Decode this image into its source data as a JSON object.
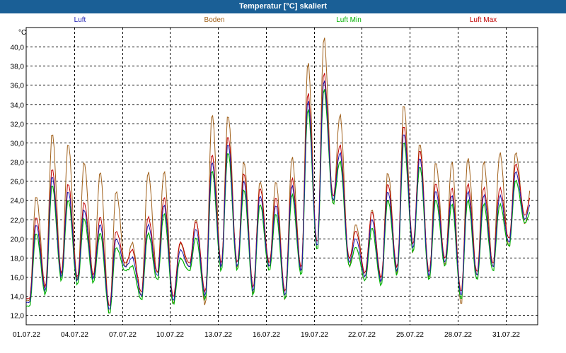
{
  "window": {
    "title": "Temperatur [°C] skaliert"
  },
  "chart_data": {
    "type": "line",
    "title": "Temperatur [°C] skaliert",
    "ylabel": "°C",
    "ylim": [
      11.0,
      42.0
    ],
    "yticks": [
      "12,0",
      "14,0",
      "16,0",
      "18,0",
      "20,0",
      "22,0",
      "24,0",
      "26,0",
      "28,0",
      "30,0",
      "32,0",
      "34,0",
      "36,0",
      "38,0",
      "40,0"
    ],
    "xticks": [
      "01.07.22",
      "04.07.22",
      "07.07.22",
      "10.07.22",
      "13.07.22",
      "16.07.22",
      "19.07.22",
      "22.07.22",
      "25.07.22",
      "28.07.22",
      "31.07.22"
    ],
    "xrange_days": [
      1.0,
      33.0
    ],
    "grid": true,
    "legend_position": "top",
    "series": [
      {
        "name": "Luft",
        "color": "#1a1ab0"
      },
      {
        "name": "Boden",
        "color": "#a0601a"
      },
      {
        "name": "Luft Min",
        "color": "#00b000"
      },
      {
        "name": "Luft Max",
        "color": "#c00000"
      }
    ],
    "daily": {
      "days": [
        1,
        2,
        3,
        4,
        5,
        6,
        7,
        8,
        9,
        10,
        11,
        12,
        13,
        14,
        15,
        16,
        17,
        18,
        19,
        20,
        21,
        22,
        23,
        24,
        25,
        26,
        27,
        28,
        29,
        30,
        31,
        32
      ],
      "luft_min": [
        13.3,
        14.5,
        16.0,
        15.5,
        15.8,
        12.5,
        17.0,
        14.0,
        16.0,
        13.5,
        17.0,
        14.0,
        17.0,
        17.0,
        14.5,
        17.0,
        14.0,
        16.5,
        19.0,
        24.0,
        17.5,
        16.0,
        15.5,
        16.5,
        19.0,
        16.0,
        17.5,
        14.0,
        16.0,
        17.0,
        19.5,
        22.0
      ],
      "luft_max": [
        21.5,
        26.5,
        25.0,
        23.0,
        21.5,
        20.0,
        18.0,
        21.5,
        23.5,
        18.8,
        21.0,
        28.0,
        30.0,
        26.0,
        24.5,
        23.5,
        25.5,
        34.5,
        36.5,
        29.0,
        20.0,
        22.0,
        25.0,
        31.0,
        28.5,
        25.0,
        24.5,
        25.0,
        24.5,
        24.5,
        27.0,
        24.0
      ],
      "boden_min": [
        13.5,
        14.8,
        16.2,
        15.5,
        15.8,
        12.0,
        17.0,
        14.0,
        16.2,
        13.2,
        17.0,
        13.0,
        17.0,
        16.8,
        14.2,
        17.0,
        13.5,
        16.5,
        18.5,
        23.5,
        17.0,
        16.0,
        15.5,
        16.2,
        18.5,
        15.8,
        17.2,
        13.0,
        16.0,
        17.0,
        19.0,
        21.5
      ],
      "boden_max": [
        24.5,
        31.0,
        30.0,
        28.0,
        27.0,
        25.0,
        19.5,
        27.0,
        27.0,
        19.5,
        22.0,
        33.0,
        33.0,
        28.0,
        26.0,
        26.0,
        28.5,
        38.5,
        41.0,
        33.0,
        21.5,
        23.0,
        27.0,
        34.0,
        30.0,
        28.0,
        28.0,
        28.5,
        28.0,
        29.0,
        29.0,
        26.0
      ]
    }
  }
}
